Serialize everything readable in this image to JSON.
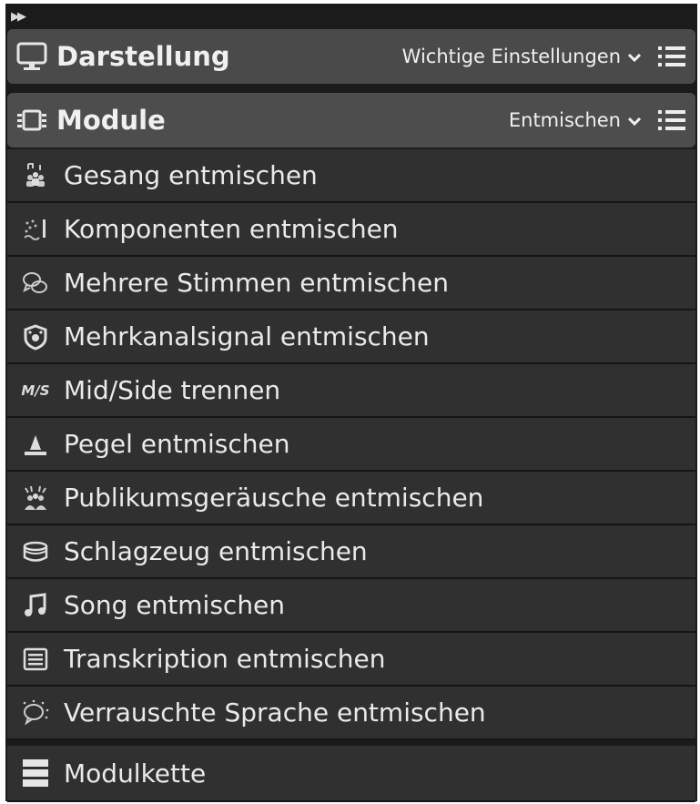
{
  "toolbar": {
    "collapse_glyph": "▶▶"
  },
  "display_section": {
    "title": "Darstellung",
    "preset": "Wichtige Einstellungen",
    "icon": "monitor-icon"
  },
  "modules_section": {
    "title": "Module",
    "preset": "Entmischen",
    "icon": "module-icon"
  },
  "items": [
    {
      "label": "Gesang entmischen",
      "icon": "choir-icon"
    },
    {
      "label": "Komponenten entmischen",
      "icon": "components-icon"
    },
    {
      "label": "Mehrere Stimmen entmischen",
      "icon": "speech-bubbles-icon"
    },
    {
      "label": "Mehrkanalsignal entmischen",
      "icon": "surround-icon"
    },
    {
      "label": "Mid/Side trennen",
      "icon": "mid-side-icon",
      "icon_text": "M/S"
    },
    {
      "label": "Pegel entmischen",
      "icon": "level-icon"
    },
    {
      "label": "Publikumsgeräusche entmischen",
      "icon": "crowd-icon"
    },
    {
      "label": "Schlagzeug entmischen",
      "icon": "drum-icon"
    },
    {
      "label": "Song entmischen",
      "icon": "music-note-icon"
    },
    {
      "label": "Transkription entmischen",
      "icon": "transcription-icon"
    },
    {
      "label": "Verrauschte Sprache entmischen",
      "icon": "noisy-speech-icon"
    }
  ],
  "chain": {
    "label": "Modulkette",
    "icon": "module-chain-icon"
  }
}
